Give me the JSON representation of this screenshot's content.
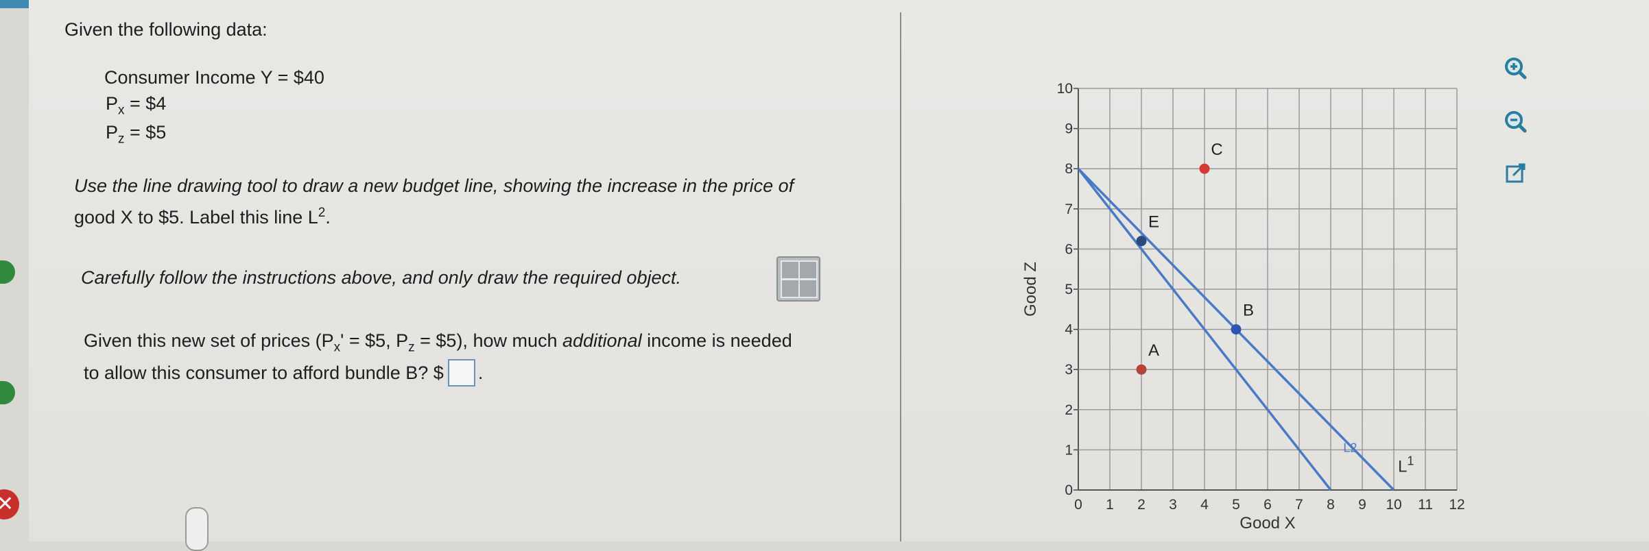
{
  "problem": {
    "heading": "Given the following data:",
    "income_line": "Consumer Income Y = $40",
    "px_label": "P",
    "px_sub": "x",
    "px_value": " = $4",
    "pz_label": "P",
    "pz_sub": "z",
    "pz_value": " = $5",
    "instruction_1": "Use the line drawing tool to draw a new budget line, showing the increase in the price of",
    "instruction_2a": "good X to $5. Label this line L",
    "instruction_2_sup": "2",
    "instruction_2b": ".",
    "instruction_3": "Carefully follow the instructions above, and only draw the required object.",
    "question_1a": "Given this new set of prices (P",
    "question_1_sub1": "x",
    "question_1b": "' = $5, P",
    "question_1_sub2": "z",
    "question_1c": " = $5), how much ",
    "question_1_italic": "additional",
    "question_1d": " income is needed",
    "question_2a": "to allow this consumer to afford bundle B? $",
    "question_2b": ".",
    "answer_value": ""
  },
  "chart_data": {
    "type": "line",
    "xlabel": "Good X",
    "ylabel": "Good Z",
    "xlim": [
      0,
      12
    ],
    "ylim": [
      0,
      10
    ],
    "x_ticks": [
      "0",
      "1",
      "2",
      "3",
      "4",
      "5",
      "6",
      "7",
      "8",
      "9",
      "10",
      "11",
      "12"
    ],
    "y_ticks": [
      "0",
      "1",
      "2",
      "3",
      "4",
      "5",
      "6",
      "7",
      "8",
      "9",
      "10"
    ],
    "grid": true,
    "series": [
      {
        "name": "L",
        "name_sup": "1",
        "points": [
          [
            0,
            8
          ],
          [
            10,
            0
          ]
        ]
      },
      {
        "name": "L2",
        "points": [
          [
            0,
            8
          ],
          [
            8,
            0
          ]
        ]
      }
    ],
    "points": [
      {
        "label": "A",
        "x": 2,
        "y": 3,
        "color": "#b5433a"
      },
      {
        "label": "B",
        "x": 5,
        "y": 4,
        "color": "#2f54b0"
      },
      {
        "label": "C",
        "x": 4,
        "y": 8,
        "color": "#d63a34"
      },
      {
        "label": "E",
        "x": 2,
        "y": 6.2,
        "color": "#2c4a7e"
      }
    ]
  },
  "colors": {
    "budget_line": "#4a79c5",
    "grid": "#9a9a9a",
    "accent": "#3f8ab3"
  },
  "icons": [
    "zoom-in-icon",
    "zoom-out-icon",
    "expand-icon",
    "line-tool-icon",
    "close-icon"
  ]
}
